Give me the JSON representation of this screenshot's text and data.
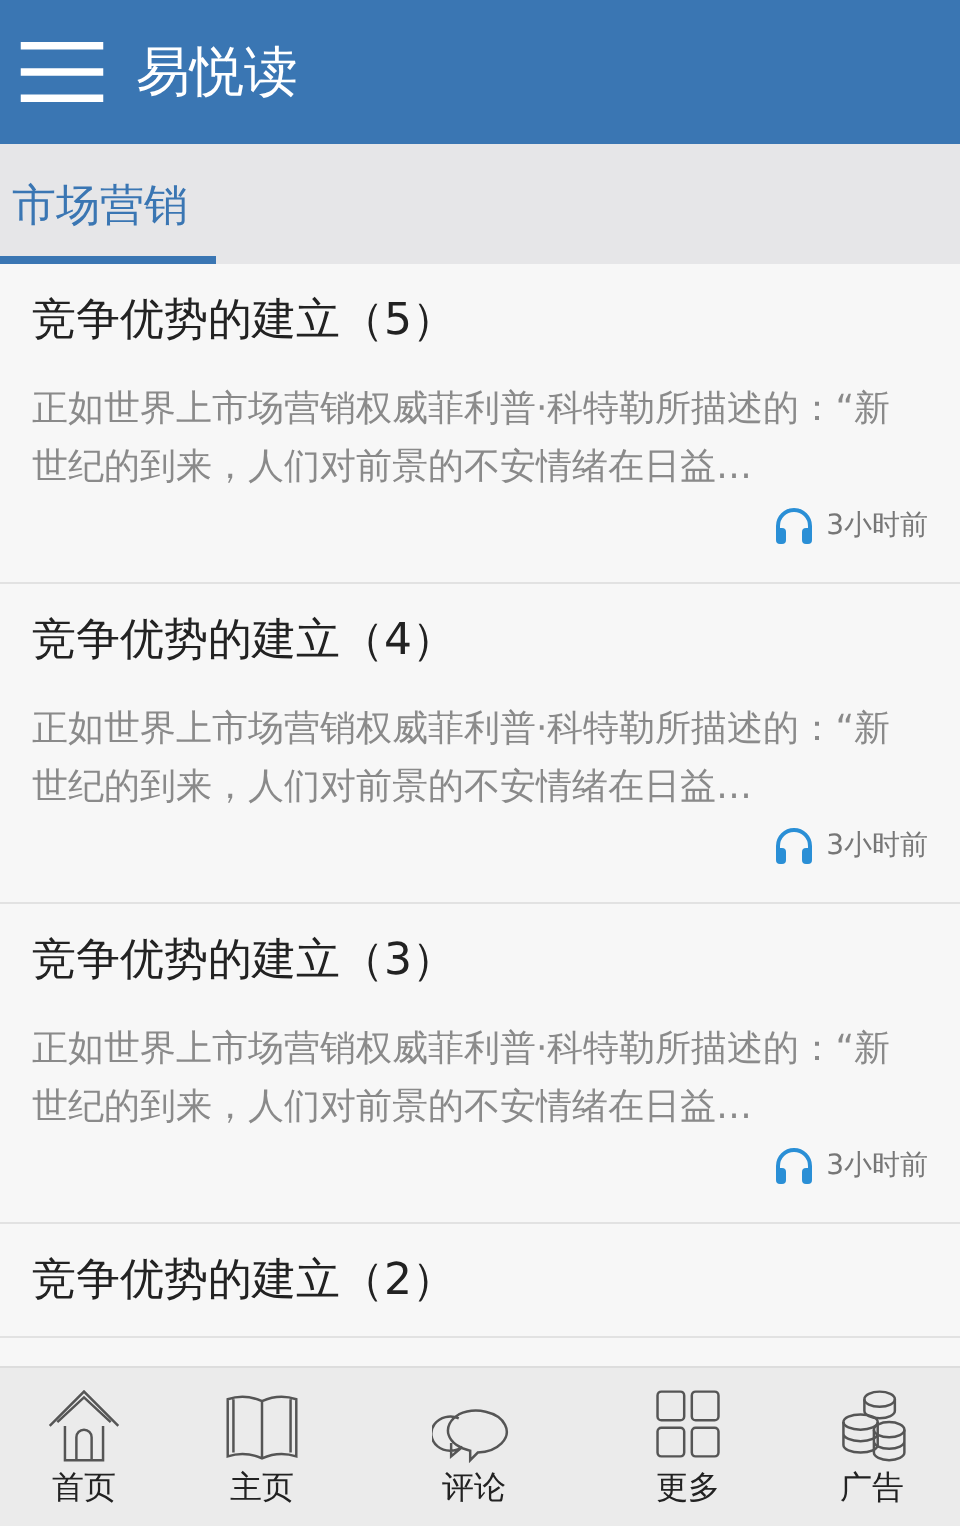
{
  "app_bar": {
    "title": "易悦读"
  },
  "tabs": [
    {
      "label": "市场营销",
      "selected": true
    }
  ],
  "articles": [
    {
      "title": "竞争优势的建立（5）",
      "summary": "正如世界上市场营销权威菲利普·科特勒所描述的：“新世纪的到来，人们对前景的不安情绪在日益…",
      "time": "3小时前"
    },
    {
      "title": "竞争优势的建立（4）",
      "summary": "正如世界上市场营销权威菲利普·科特勒所描述的：“新世纪的到来，人们对前景的不安情绪在日益…",
      "time": "3小时前"
    },
    {
      "title": "竞争优势的建立（3）",
      "summary": "正如世界上市场营销权威菲利普·科特勒所描述的：“新世纪的到来，人们对前景的不安情绪在日益…",
      "time": "3小时前"
    },
    {
      "title": "竞争优势的建立（2）"
    }
  ],
  "bottom_nav": [
    {
      "kind": "home",
      "label": "首页"
    },
    {
      "kind": "book",
      "label": "主页"
    },
    {
      "kind": "chat",
      "label": "评论"
    },
    {
      "kind": "grid",
      "label": "更多"
    },
    {
      "kind": "coins",
      "label": "广告"
    }
  ]
}
